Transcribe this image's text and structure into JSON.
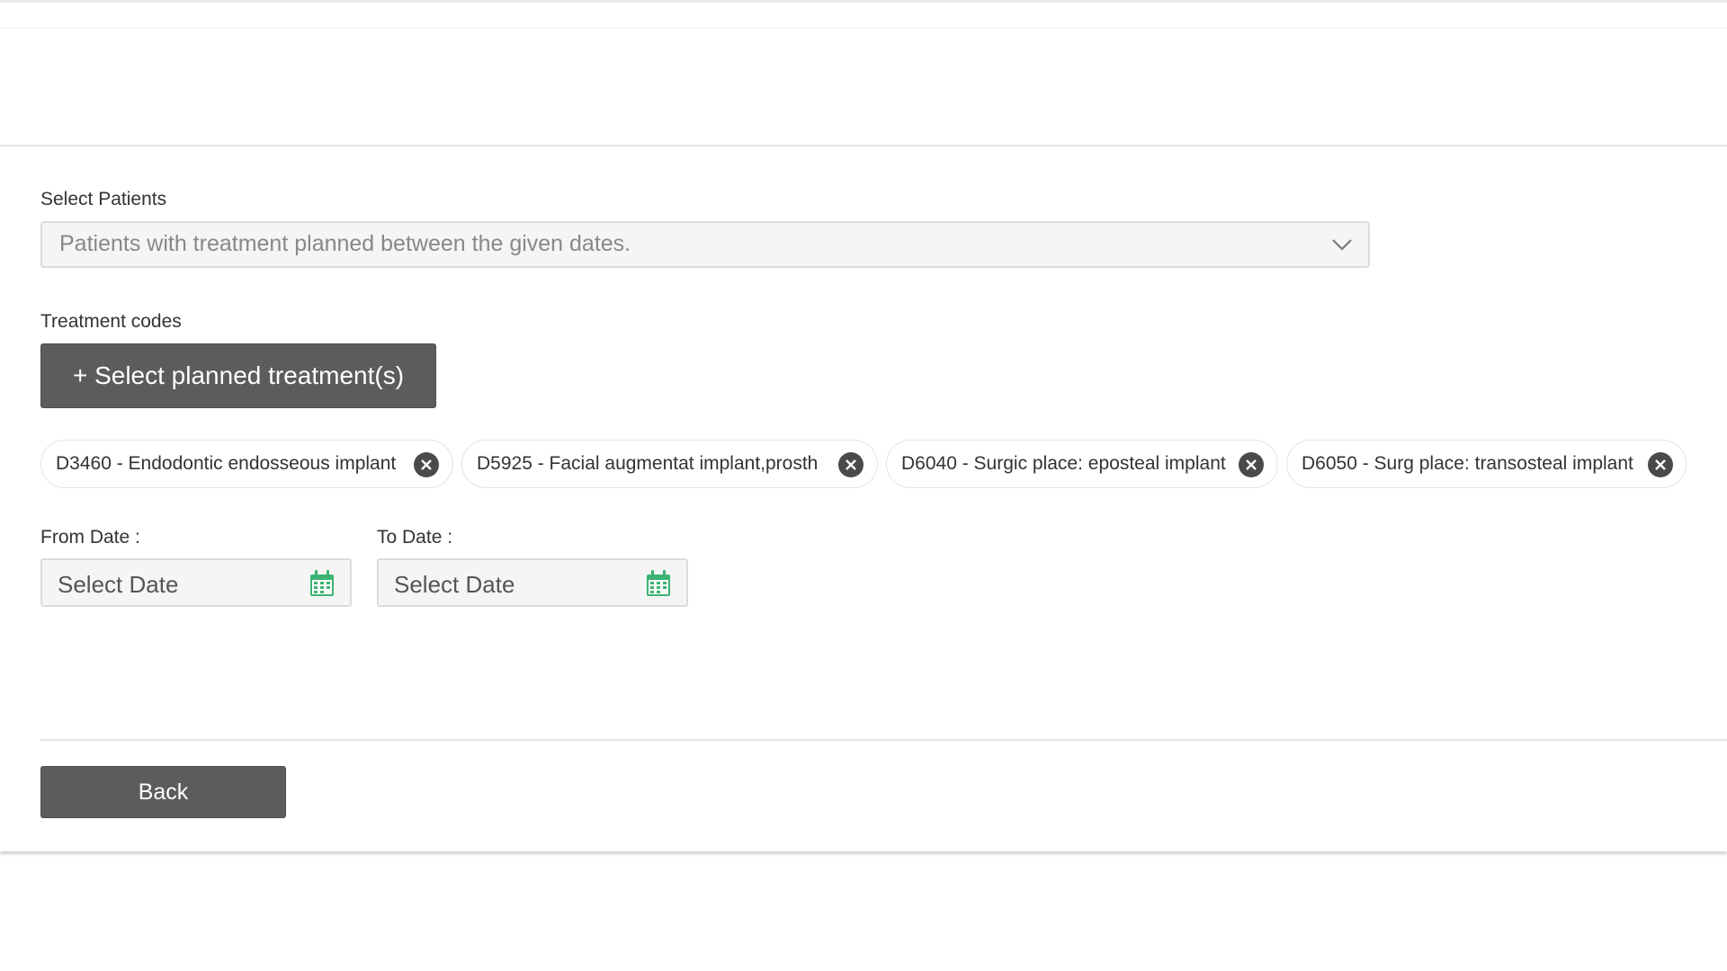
{
  "patients": {
    "label": "Select Patients",
    "selected": "Patients with treatment planned between the given dates."
  },
  "treatment": {
    "label": "Treatment codes",
    "button_label": "+ Select planned treatment(s)",
    "chips": [
      {
        "label": "D3460 - Endodontic endosseous implant"
      },
      {
        "label": "D5925 - Facial augmentat implant,prosth"
      },
      {
        "label": "D6040 - Surgic place: eposteal implant"
      },
      {
        "label": "D6050 - Surg place: transosteal implant"
      }
    ]
  },
  "dates": {
    "from_label": "From Date :",
    "to_label": "To Date :",
    "from_placeholder": "Select Date",
    "to_placeholder": "Select Date"
  },
  "footer": {
    "back_label": "Back"
  },
  "colors": {
    "button_bg": "#5c5c5c",
    "calendar_icon": "#3cb371",
    "chip_remove_icon": "#4a4a4a"
  }
}
